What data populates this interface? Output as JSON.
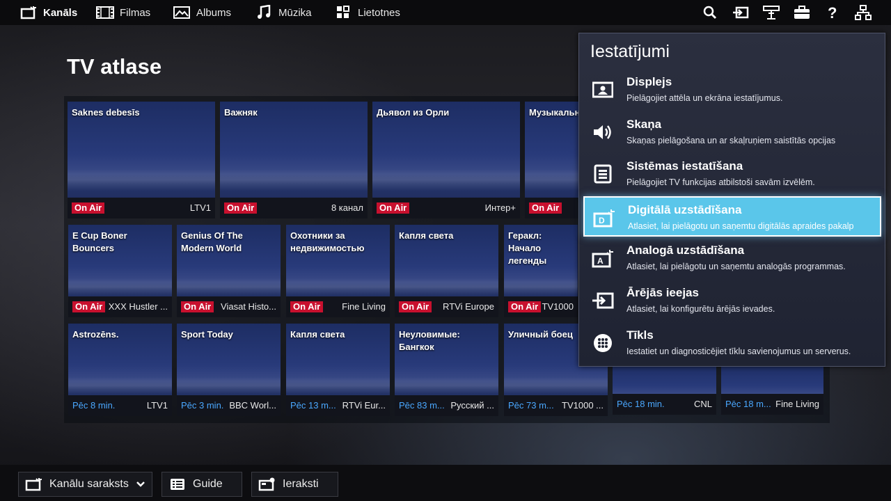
{
  "nav": {
    "items": [
      {
        "label": "Kanāls",
        "icon": "tv-icon"
      },
      {
        "label": "Filmas",
        "icon": "film-icon"
      },
      {
        "label": "Albums",
        "icon": "picture-icon"
      },
      {
        "label": "Mūzika",
        "icon": "music-icon"
      },
      {
        "label": "Lietotnes",
        "icon": "apps-icon"
      }
    ],
    "right_icons": [
      "search-icon",
      "input-icon",
      "remote-icon",
      "toolbox-icon",
      "help-icon",
      "network-icon"
    ]
  },
  "page_title": "TV atlase",
  "grid": {
    "row1": [
      {
        "title": "Saknes debesīs",
        "status": "On Air",
        "channel": "LTV1"
      },
      {
        "title": "Важняк",
        "status": "On Air",
        "channel": "8 канал"
      },
      {
        "title": "Дьявол из Орли",
        "status": "On Air",
        "channel": "Интер+"
      },
      {
        "title": "Музыкальный",
        "status": "On Air",
        "channel": ""
      }
    ],
    "row2": [
      {
        "title": "E Cup Boner Bouncers",
        "status": "On Air",
        "channel": "XXX Hustler ..."
      },
      {
        "title": "Genius Of The Modern World",
        "status": "On Air",
        "channel": "Viasat Histo..."
      },
      {
        "title": "Охотники за недвижимостью",
        "status": "On Air",
        "channel": "Fine Living"
      },
      {
        "title": "Капля света",
        "status": "On Air",
        "channel": "RTVi Europe"
      },
      {
        "title": "Геракл: Начало легенды",
        "status": "On Air",
        "channel": "TV1000"
      }
    ],
    "row3": [
      {
        "title": "Astrozēns.",
        "status": "Pēc 8 min.",
        "channel": "LTV1"
      },
      {
        "title": "Sport Today",
        "status": "Pēc 3 min.",
        "channel": "BBC Worl..."
      },
      {
        "title": "Капля света",
        "status": "Pēc 13 m...",
        "channel": "RTVi Eur..."
      },
      {
        "title": "Неуловимые: Бангкок",
        "status": "Pēc 83 m...",
        "channel": "Русский ..."
      },
      {
        "title": "Уличный боец",
        "status": "Pēc 73 m...",
        "channel": "TV1000 ..."
      },
      {
        "title": "",
        "status": "Pēc 18 min.",
        "channel": "CNL"
      },
      {
        "title": "",
        "status": "Pēc 18 m...",
        "channel": "Fine Living"
      }
    ]
  },
  "settings_panel": {
    "title": "Iestatījumi",
    "items": [
      {
        "label": "Displejs",
        "desc": "Pielāgojiet attēla un ekrāna iestatījumus.",
        "icon": "display-icon"
      },
      {
        "label": "Skaņa",
        "desc": "Skaņas pielāgošana un ar skaļruņiem saistītās opcijas",
        "icon": "speaker-icon"
      },
      {
        "label": "Sistēmas iestatīšana",
        "desc": "Pielāgojiet TV funkcijas atbilstoši savām izvēlēm.",
        "icon": "system-settings-icon"
      },
      {
        "label": "Digitālā uzstādīšana",
        "desc": "Atlasiet, lai pielāgotu un saņemtu digitālās apraides pakalp",
        "icon": "digital-antenna-icon"
      },
      {
        "label": "Analogā uzstādīšana",
        "desc": "Atlasiet, lai pielāgotu un saņemtu analogās programmas.",
        "icon": "analog-antenna-icon"
      },
      {
        "label": "Ārējās ieejas",
        "desc": "Atlasiet, lai konfigurētu ārējās ievades.",
        "icon": "external-input-icon"
      },
      {
        "label": "Tīkls",
        "desc": "Iestatiet un diagnosticējiet tīklu savienojumus un serverus.",
        "icon": "globe-icon"
      }
    ],
    "selected_index": 3,
    "highlight_color": "#5ac6ea"
  },
  "bottom": {
    "channel_list": "Kanālu saraksts",
    "guide": "Guide",
    "recordings": "Ieraksti"
  },
  "colors": {
    "on_air": "#c8102e",
    "upcoming": "#4aa8ff"
  }
}
